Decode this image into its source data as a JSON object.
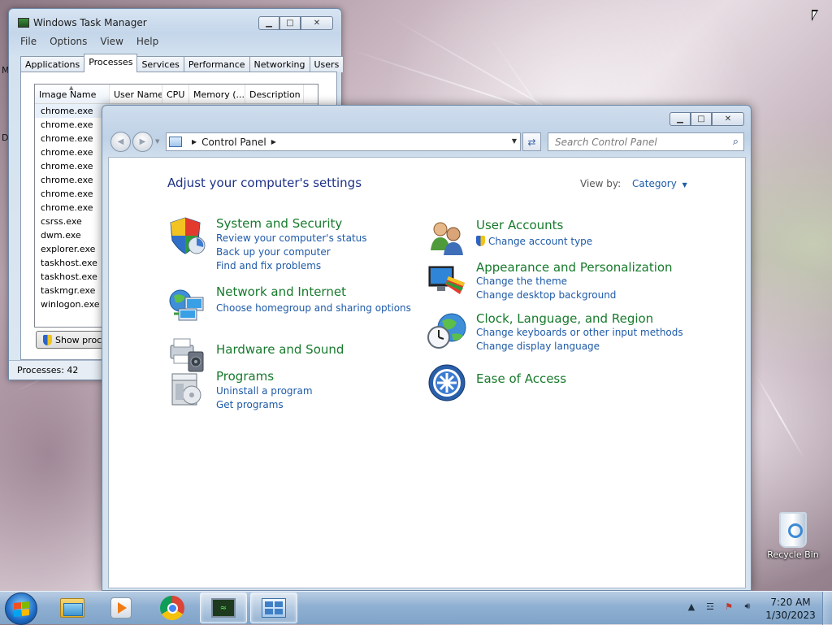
{
  "desktop": {
    "recycle_bin_label": "Recycle Bin",
    "edge_letters": [
      "M",
      "D"
    ]
  },
  "task_manager": {
    "title": "Windows Task Manager",
    "menu": [
      "File",
      "Options",
      "View",
      "Help"
    ],
    "tabs": [
      "Applications",
      "Processes",
      "Services",
      "Performance",
      "Networking",
      "Users"
    ],
    "active_tab": "Processes",
    "columns": [
      "Image Name",
      "User Name",
      "CPU",
      "Memory (...",
      "Description"
    ],
    "processes": [
      "chrome.exe",
      "chrome.exe",
      "chrome.exe",
      "chrome.exe",
      "chrome.exe",
      "chrome.exe",
      "chrome.exe",
      "chrome.exe",
      "csrss.exe",
      "dwm.exe",
      "explorer.exe",
      "taskhost.exe",
      "taskhost.exe",
      "taskmgr.exe",
      "winlogon.exe"
    ],
    "show_button": "Show processes from all users",
    "status": "Processes: 42"
  },
  "control_panel": {
    "address": "Control Panel",
    "search_placeholder": "Search Control Panel",
    "heading": "Adjust your computer's settings",
    "view_by_label": "View by:",
    "view_by_value": "Category",
    "categories": {
      "system": {
        "title": "System and Security",
        "links": [
          "Review your computer's status",
          "Back up your computer",
          "Find and fix problems"
        ]
      },
      "network": {
        "title": "Network and Internet",
        "links": [
          "Choose homegroup and sharing options"
        ]
      },
      "hardware": {
        "title": "Hardware and Sound",
        "links": []
      },
      "programs": {
        "title": "Programs",
        "links": [
          "Uninstall a program",
          "Get programs"
        ]
      },
      "users": {
        "title": "User Accounts",
        "links": [
          "Change account type"
        ]
      },
      "appearance": {
        "title": "Appearance and Personalization",
        "links": [
          "Change the theme",
          "Change desktop background"
        ]
      },
      "clock": {
        "title": "Clock, Language, and Region",
        "links": [
          "Change keyboards or other input methods",
          "Change display language"
        ]
      },
      "ease": {
        "title": "Ease of Access",
        "links": []
      }
    }
  },
  "taskbar": {
    "time": "7:20 AM",
    "date": "1/30/2023",
    "pinned": [
      "windows-explorer-icon",
      "media-player-icon",
      "chrome-icon",
      "task-manager-icon",
      "control-panel-icon"
    ]
  },
  "colors": {
    "category_green": "#177a2c",
    "link_blue": "#1e5aa8",
    "heading_blue": "#1e3287"
  }
}
